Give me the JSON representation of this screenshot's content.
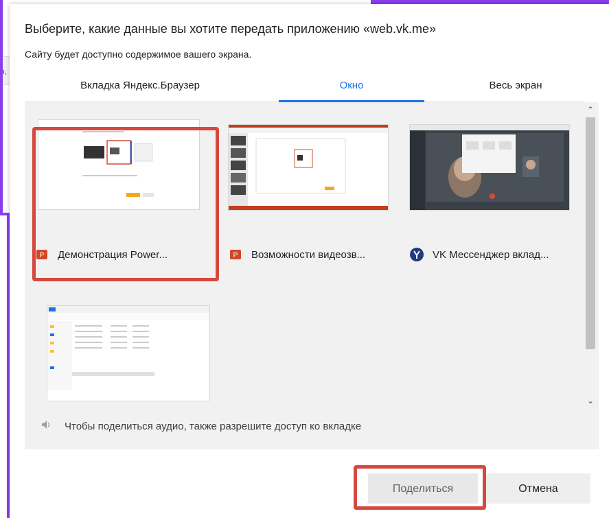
{
  "background": {
    "left_text": "о,"
  },
  "dialog": {
    "title": "Выберите, какие данные вы хотите передать приложению «web.vk.me»",
    "subtitle": "Сайту будет доступно содержимое вашего экрана."
  },
  "tabs": [
    {
      "label": "Вкладка Яндекс.Браузер",
      "active": false
    },
    {
      "label": "Окно",
      "active": true
    },
    {
      "label": "Весь экран",
      "active": false
    }
  ],
  "windows": [
    {
      "title": "Демонстрация Power...",
      "icon": "powerpoint-icon",
      "selected": true
    },
    {
      "title": "Возможности видеозв...",
      "icon": "powerpoint-icon",
      "selected": false
    },
    {
      "title": "VK Мессенджер вклад...",
      "icon": "yandex-browser-icon",
      "selected": false
    },
    {
      "title": "",
      "icon": "file-explorer-icon",
      "selected": false
    }
  ],
  "audio": {
    "text": "Чтобы поделиться аудио, также разрешите доступ ко вкладке",
    "icon": "speaker-icon"
  },
  "buttons": {
    "share": "Поделиться",
    "cancel": "Отмена"
  },
  "colors": {
    "accent": "#1a73e8",
    "highlight": "#d6483e",
    "frame": "#8b3cf0",
    "panel": "#f1f1f1"
  }
}
